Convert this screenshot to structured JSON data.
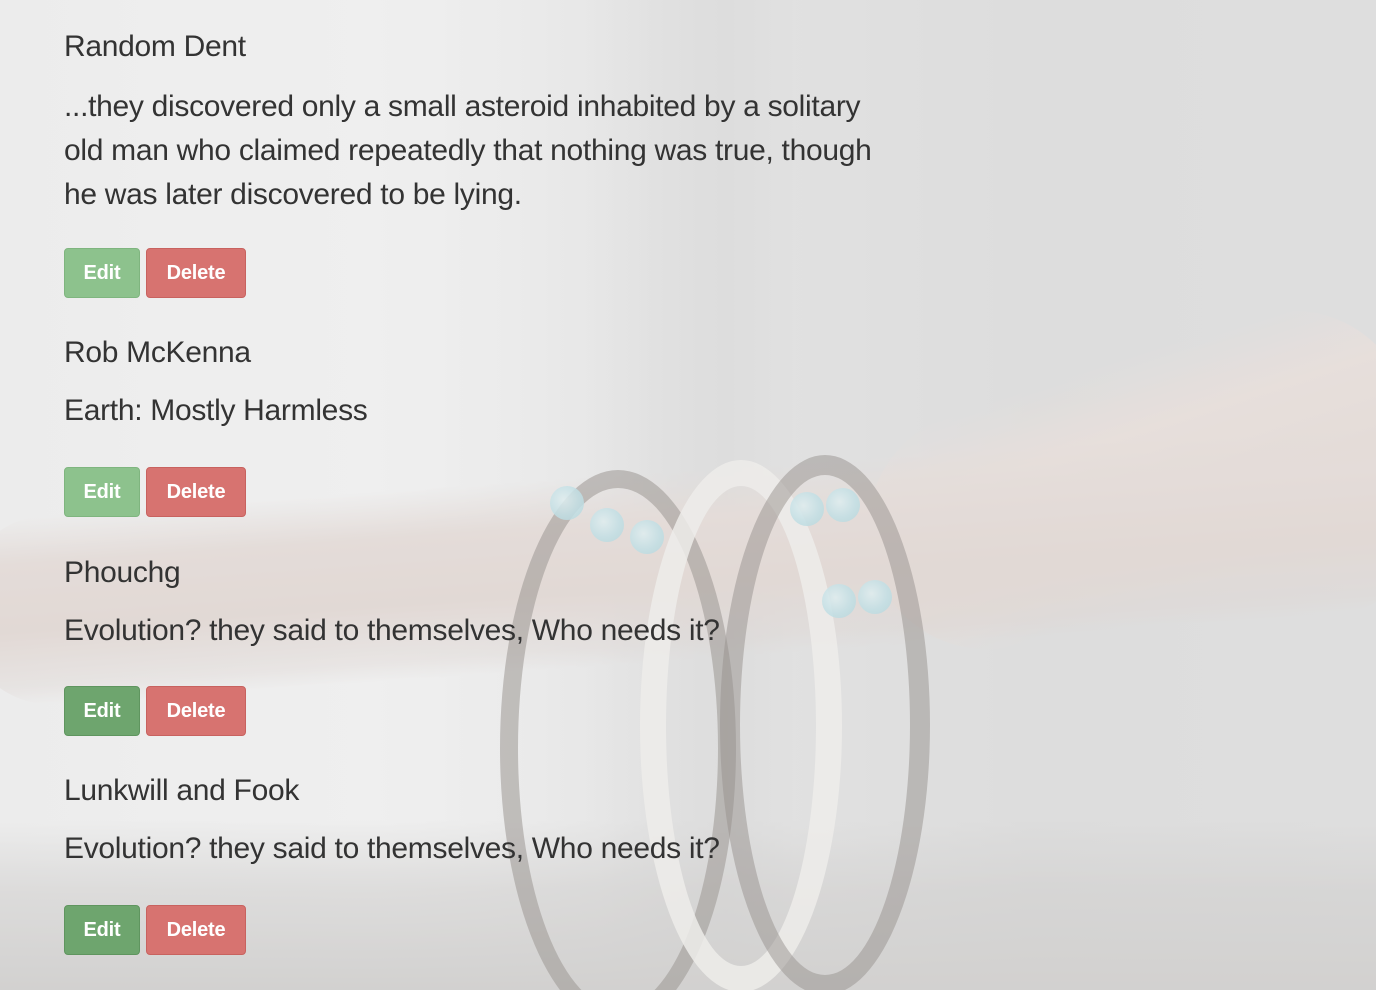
{
  "entries": [
    {
      "author": "Random Dent",
      "quote": "...they discovered only a small asteroid inhabited by a solitary old man who claimed repeatedly that nothing was true, though he was later discovered to be lying.",
      "edit_label": "Edit",
      "delete_label": "Delete"
    },
    {
      "author": "Rob McKenna",
      "quote": "Earth: Mostly Harmless",
      "edit_label": "Edit",
      "delete_label": "Delete"
    },
    {
      "author": "Phouchg",
      "quote": "Evolution? they said to themselves, Who needs it?",
      "edit_label": "Edit",
      "delete_label": "Delete"
    },
    {
      "author": "Lunkwill and Fook",
      "quote": "Evolution? they said to themselves, Who needs it?",
      "edit_label": "Edit",
      "delete_label": "Delete"
    }
  ],
  "colors": {
    "edit_button": "#8dc28d",
    "edit_button_active": "#6ea56e",
    "delete_button": "#d77370",
    "text": "#333333"
  }
}
